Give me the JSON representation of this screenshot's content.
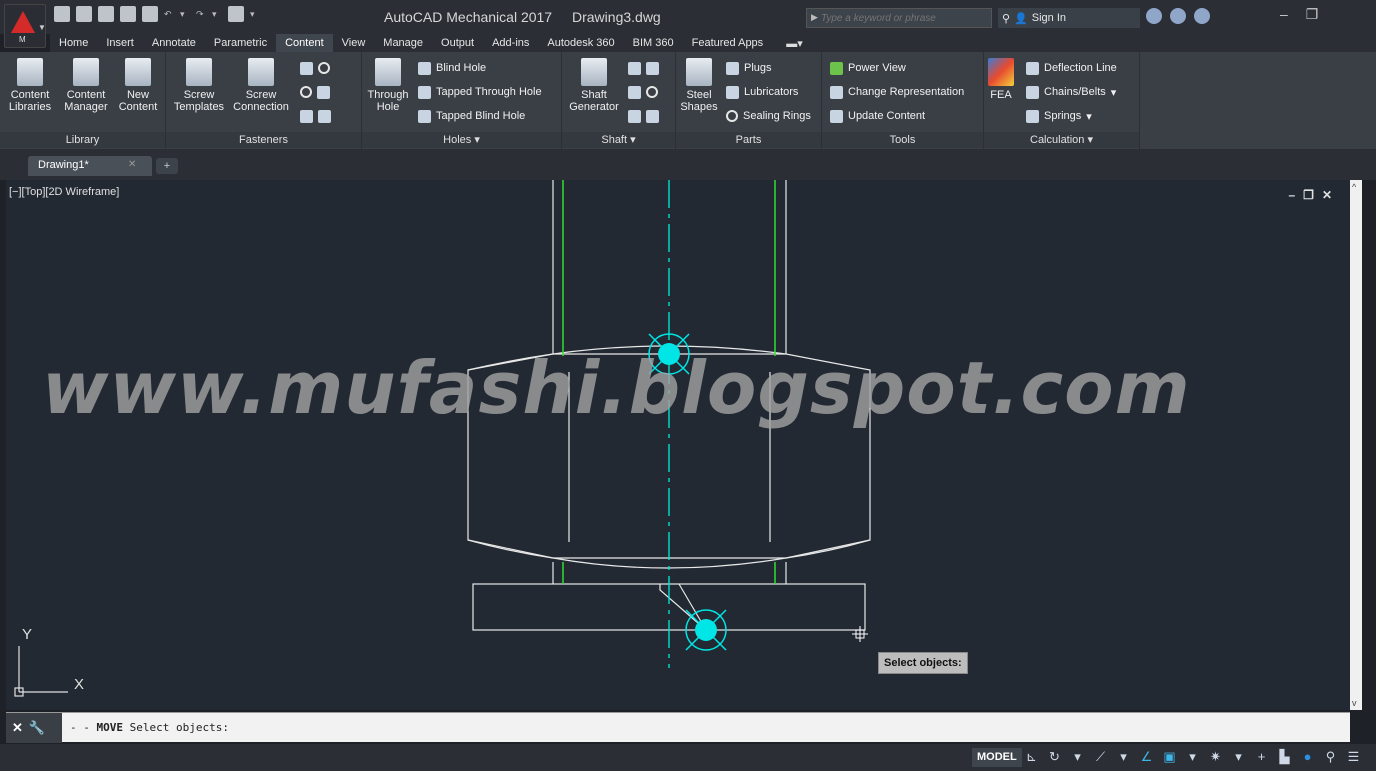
{
  "app": {
    "title": "AutoCAD Mechanical 2017",
    "file": "Drawing3.dwg",
    "logo_letter": "M"
  },
  "search": {
    "placeholder": "Type a keyword or phrase"
  },
  "account": {
    "signin_label": "Sign In"
  },
  "ribbon_tabs": [
    "Home",
    "Insert",
    "Annotate",
    "Parametric",
    "Content",
    "View",
    "Manage",
    "Output",
    "Add-ins",
    "Autodesk 360",
    "BIM 360",
    "Featured Apps"
  ],
  "active_tab": "Content",
  "ribbon": {
    "library": {
      "label": "Library",
      "buttons": [
        "Content Libraries",
        "Content Manager",
        "New Content"
      ]
    },
    "fasteners": {
      "label": "Fasteners",
      "buttons": [
        "Screw Templates",
        "Screw Connection"
      ]
    },
    "holes": {
      "label": "Holes",
      "through_hole": "Through Hole",
      "items": [
        "Blind Hole",
        "Tapped Through Hole",
        "Tapped Blind Hole"
      ]
    },
    "shaft": {
      "label": "Shaft",
      "generator": "Shaft Generator"
    },
    "parts": {
      "label": "Parts",
      "steel_shapes": "Steel Shapes",
      "items": [
        "Plugs",
        "Lubricators",
        "Sealing Rings"
      ]
    },
    "tools": {
      "label": "Tools",
      "items": [
        "Power View",
        "Change Representation",
        "Update Content"
      ]
    },
    "calculation": {
      "label": "Calculation",
      "fea": "FEA",
      "items": [
        "Deflection Line",
        "Chains/Belts",
        "Springs"
      ]
    }
  },
  "file_tabs": {
    "active": "Drawing1*",
    "add": "+"
  },
  "viewport": {
    "label": "[−][Top][2D Wireframe]"
  },
  "watermark": "www.mufashi.blogspot.com",
  "ucs": {
    "x": "X",
    "y": "Y"
  },
  "tooltip": "Select objects:",
  "command_line": {
    "command": "MOVE",
    "prompt": "Select objects:",
    "prefix": "- -"
  },
  "status_bar": {
    "model": "MODEL"
  },
  "colors": {
    "accent_cyan": "#00e5e5",
    "green_line": "#2fe02f",
    "canvas_bg": "#222933"
  }
}
